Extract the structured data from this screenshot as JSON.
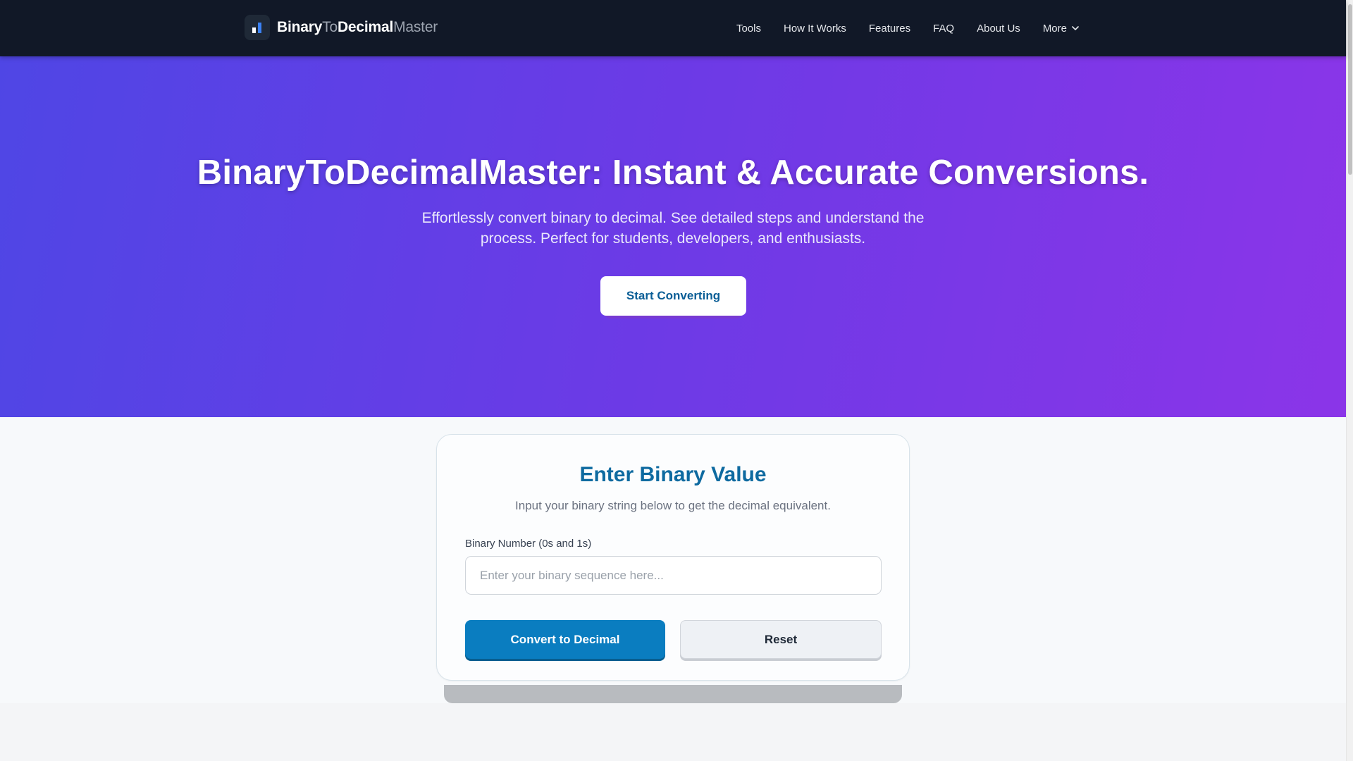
{
  "brand": {
    "part1": "Binary",
    "part2": "To",
    "part3": "Decimal",
    "part4": "Master",
    "icon": "bar-chart-icon"
  },
  "nav": {
    "items": [
      {
        "label": "Tools"
      },
      {
        "label": "How It Works"
      },
      {
        "label": "Features"
      },
      {
        "label": "FAQ"
      },
      {
        "label": "About Us"
      },
      {
        "label": "More",
        "icon": "chevron-down-icon"
      }
    ]
  },
  "hero": {
    "title": "BinaryToDecimalMaster: Instant & Accurate Conversions.",
    "subtitle": "Effortlessly convert binary to decimal. See detailed steps and understand the process. Perfect for students, developers, and enthusiasts.",
    "cta_label": "Start Converting"
  },
  "converter": {
    "title": "Enter Binary Value",
    "subtitle": "Input your binary string below to get the decimal equivalent.",
    "field_label": "Binary Number (0s and 1s)",
    "placeholder": "Enter your binary sequence here...",
    "value": "",
    "convert_label": "Convert to Decimal",
    "reset_label": "Reset"
  },
  "colors": {
    "nav_bg": "#111827",
    "hero_start": "#4f46e5",
    "hero_end": "#8b35e8",
    "accent": "#0a7dc0",
    "title_blue": "#0e6aa0"
  }
}
